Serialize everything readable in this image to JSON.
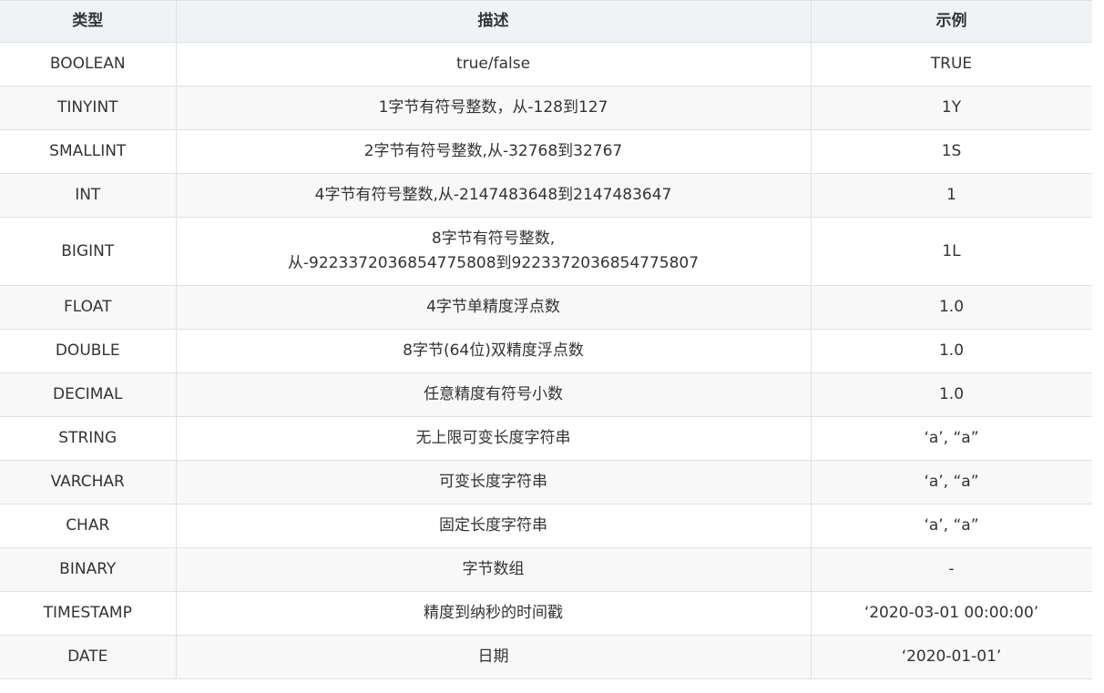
{
  "table": {
    "headers": [
      "类型",
      "描述",
      "示例"
    ],
    "rows": [
      {
        "type": "BOOLEAN",
        "desc": [
          "true/false"
        ],
        "example": "TRUE"
      },
      {
        "type": "TINYINT",
        "desc": [
          "1字节有符号整数，从-128到127"
        ],
        "example": "1Y"
      },
      {
        "type": "SMALLINT",
        "desc": [
          "2字节有符号整数,从-32768到32767"
        ],
        "example": "1S"
      },
      {
        "type": "INT",
        "desc": [
          "4字节有符号整数,从-2147483648到2147483647"
        ],
        "example": "1"
      },
      {
        "type": "BIGINT",
        "desc": [
          "8字节有符号整数,",
          "从-9223372036854775808到9223372036854775807"
        ],
        "example": "1L"
      },
      {
        "type": "FLOAT",
        "desc": [
          "4字节单精度浮点数"
        ],
        "example": "1.0"
      },
      {
        "type": "DOUBLE",
        "desc": [
          "8字节(64位)双精度浮点数"
        ],
        "example": "1.0"
      },
      {
        "type": "DECIMAL",
        "desc": [
          "任意精度有符号小数"
        ],
        "example": "1.0"
      },
      {
        "type": "STRING",
        "desc": [
          "无上限可变长度字符串"
        ],
        "example": "‘a’, “a”"
      },
      {
        "type": "VARCHAR",
        "desc": [
          "可变长度字符串"
        ],
        "example": "‘a’, “a”"
      },
      {
        "type": "CHAR",
        "desc": [
          "固定长度字符串"
        ],
        "example": "‘a’, “a”"
      },
      {
        "type": "BINARY",
        "desc": [
          "字节数组"
        ],
        "example": "-"
      },
      {
        "type": "TIMESTAMP",
        "desc": [
          "精度到纳秒的时间戳"
        ],
        "example": "‘2020-03-01 00:00:00’"
      },
      {
        "type": "DATE",
        "desc": [
          "日期"
        ],
        "example": "‘2020-01-01’"
      }
    ]
  }
}
